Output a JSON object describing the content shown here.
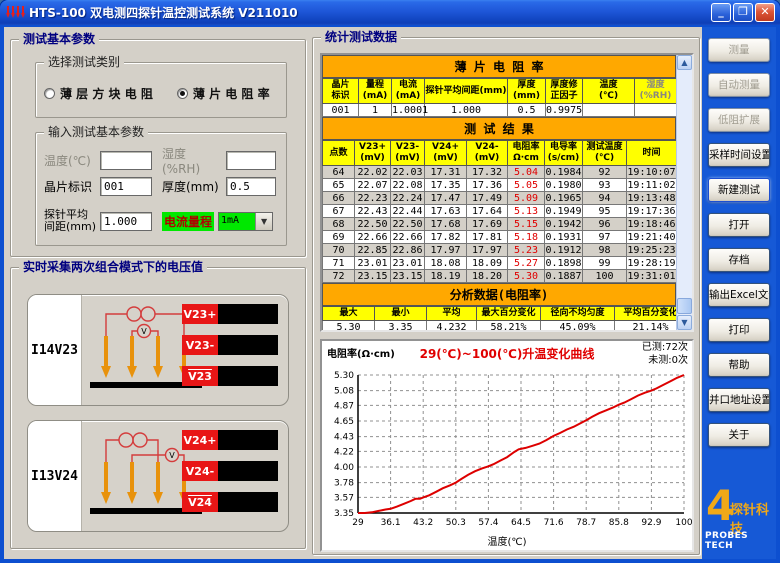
{
  "window": {
    "title": "HTS-100 双电测四探针温控测试系统  V211010"
  },
  "titlebar": {
    "minimize": "_",
    "restore": "❐",
    "close": "✕"
  },
  "left": {
    "params_group": {
      "title": "测试基本参数",
      "category_group": {
        "title": "选择测试类别",
        "radios": [
          {
            "label": "薄 层 方 块 电 阻",
            "selected": false
          },
          {
            "label": "薄 片 电 阻 率",
            "selected": true
          }
        ]
      },
      "input_group": {
        "title": "输入测试基本参数",
        "temp_label": "温度(℃)",
        "temp_value": "",
        "humidity_label": "湿度(%RH)",
        "humidity_value": "",
        "wafer_label": "晶片标识",
        "wafer_value": "001",
        "thickness_label": "厚度(mm)",
        "thickness_value": "0.5",
        "spacing_label_line1": "探针平均",
        "spacing_label_line2": "间距(mm)",
        "spacing_value": "1.000",
        "range_label": "电流量程",
        "range_value": "1mA"
      }
    },
    "voltage_group": {
      "title": "实时采集两次组合模式下的电压值",
      "panels": [
        {
          "mode": "I14V23",
          "labels": [
            "V23+",
            "V23-",
            "V23"
          ]
        },
        {
          "mode": "I13V24",
          "labels": [
            "V24+",
            "V24-",
            "V24"
          ]
        }
      ]
    }
  },
  "stats": {
    "title": "统计测试数据",
    "sheet_table": {
      "section": "薄 片 电 阻 率",
      "headers": [
        "晶片\n标识",
        "量程\n(mA)",
        "电流\n(mA)",
        "探针平均间距(mm)",
        "厚度\n(mm)",
        "厚度修\n正因子",
        "温度\n(℃)",
        "湿度\n(%RH)"
      ],
      "gray_headers": [
        7
      ],
      "widths": [
        36,
        33,
        33,
        83,
        38,
        37,
        52,
        42
      ],
      "rows": [
        [
          "001",
          "1",
          "1.0001",
          "1.000",
          "0.5",
          "0.9975",
          "",
          ""
        ]
      ]
    },
    "result_table": {
      "section": "测 试 结 果",
      "headers": [
        "点数",
        "V23+\n(mV)",
        "V23-\n(mV)",
        "V24+\n(mV)",
        "V24-\n(mV)",
        "电阻率\nΩ·cm",
        "电导率\n(s/cm)",
        "测试温度\n(℃)",
        "时间"
      ],
      "widths": [
        32,
        36,
        34,
        42,
        41,
        37,
        38,
        44,
        50
      ],
      "red_col": 5,
      "zebra": true,
      "rows": [
        [
          "64",
          "22.02",
          "22.03",
          "17.31",
          "17.32",
          "5.04",
          "0.1984",
          "92",
          "19:10:07"
        ],
        [
          "65",
          "22.07",
          "22.08",
          "17.35",
          "17.36",
          "5.05",
          "0.1980",
          "93",
          "19:11:02"
        ],
        [
          "66",
          "22.23",
          "22.24",
          "17.47",
          "17.49",
          "5.09",
          "0.1965",
          "94",
          "19:13:48"
        ],
        [
          "67",
          "22.43",
          "22.44",
          "17.63",
          "17.64",
          "5.13",
          "0.1949",
          "95",
          "19:17:36"
        ],
        [
          "68",
          "22.50",
          "22.50",
          "17.68",
          "17.69",
          "5.15",
          "0.1942",
          "96",
          "19:18:46"
        ],
        [
          "69",
          "22.66",
          "22.66",
          "17.82",
          "17.81",
          "5.18",
          "0.1931",
          "97",
          "19:21:40"
        ],
        [
          "70",
          "22.85",
          "22.86",
          "17.97",
          "17.97",
          "5.23",
          "0.1912",
          "98",
          "19:25:23"
        ],
        [
          "71",
          "23.01",
          "23.01",
          "18.08",
          "18.09",
          "5.27",
          "0.1898",
          "99",
          "19:28:19"
        ],
        [
          "72",
          "23.15",
          "23.15",
          "18.19",
          "18.20",
          "5.30",
          "0.1887",
          "100",
          "19:31:01"
        ]
      ]
    },
    "analysis_table": {
      "section": "分析数据(电阻率)",
      "headers": [
        "最大",
        "最小",
        "平均",
        "最大百分变化",
        "径向不均匀度",
        "平均百分变化"
      ],
      "widths": [
        52,
        52,
        50,
        64,
        74,
        72
      ],
      "rows": [
        [
          "5.30",
          "3.35",
          "4.232",
          "58.21%",
          "45.09%",
          "21.14%"
        ]
      ]
    },
    "counters": {
      "measured": "已测:72次",
      "remaining": "未测:0次"
    }
  },
  "chart_data": {
    "type": "line",
    "title": "29(℃)~100(℃)升温变化曲线",
    "xlabel": "温度(℃)",
    "ylabel": "电阻率(Ω·cm)",
    "xlim": [
      29,
      100
    ],
    "ylim": [
      3.35,
      5.3
    ],
    "xticks": [
      29,
      36.1,
      43.2,
      50.3,
      57.4,
      64.5,
      71.6,
      78.7,
      85.8,
      92.9,
      100
    ],
    "yticks": [
      5.3,
      5.08,
      4.87,
      4.65,
      4.43,
      4.22,
      4.0,
      3.78,
      3.57,
      3.35
    ],
    "grid": true,
    "line_color": "#dd0000",
    "series": [
      {
        "name": "电阻率",
        "points": [
          [
            29,
            3.35
          ],
          [
            30.5,
            3.35
          ],
          [
            32,
            3.36
          ],
          [
            33.5,
            3.38
          ],
          [
            35,
            3.4
          ],
          [
            36.1,
            3.41
          ],
          [
            37.5,
            3.44
          ],
          [
            39,
            3.48
          ],
          [
            40.5,
            3.52
          ],
          [
            41.5,
            3.55
          ],
          [
            42.5,
            3.55
          ],
          [
            43.2,
            3.57
          ],
          [
            44.5,
            3.6
          ],
          [
            46,
            3.65
          ],
          [
            47.5,
            3.7
          ],
          [
            49,
            3.74
          ],
          [
            50.3,
            3.78
          ],
          [
            51.5,
            3.83
          ],
          [
            53,
            3.89
          ],
          [
            54.5,
            3.94
          ],
          [
            56,
            3.98
          ],
          [
            57.4,
            4.01
          ],
          [
            58.5,
            4.04
          ],
          [
            60,
            4.09
          ],
          [
            61.5,
            4.14
          ],
          [
            63,
            4.21
          ],
          [
            64,
            4.25
          ],
          [
            65.5,
            4.27
          ],
          [
            67,
            4.3
          ],
          [
            68.5,
            4.33
          ],
          [
            70,
            4.38
          ],
          [
            71.6,
            4.44
          ],
          [
            73,
            4.48
          ],
          [
            74.5,
            4.53
          ],
          [
            76,
            4.57
          ],
          [
            77.5,
            4.62
          ],
          [
            78.7,
            4.66
          ],
          [
            80,
            4.71
          ],
          [
            81.5,
            4.76
          ],
          [
            83,
            4.8
          ],
          [
            84.5,
            4.84
          ],
          [
            85.8,
            4.88
          ],
          [
            87,
            4.91
          ],
          [
            88.5,
            4.96
          ],
          [
            90,
            5.01
          ],
          [
            91.5,
            5.05
          ],
          [
            92.9,
            5.08
          ],
          [
            94,
            5.11
          ],
          [
            95.5,
            5.16
          ],
          [
            97,
            5.21
          ],
          [
            98.5,
            5.26
          ],
          [
            100,
            5.3
          ]
        ]
      }
    ]
  },
  "sidebar": {
    "buttons": [
      {
        "name": "measure",
        "label": "测量",
        "enabled": false
      },
      {
        "name": "auto-measure",
        "label": "自动测量",
        "enabled": false
      },
      {
        "name": "low-resistance-extend",
        "label": "低阻扩展",
        "enabled": false
      },
      {
        "name": "sampling-time-settings",
        "label": "采样时间设置",
        "enabled": true
      },
      {
        "name": "new-test",
        "label": "新建测试",
        "enabled": true,
        "focused": true
      },
      {
        "name": "open",
        "label": "打开",
        "enabled": true
      },
      {
        "name": "archive",
        "label": "存档",
        "enabled": true
      },
      {
        "name": "export-excel",
        "label": "输出Excel文件",
        "enabled": true
      },
      {
        "name": "print",
        "label": "打印",
        "enabled": true
      },
      {
        "name": "help",
        "label": "帮助",
        "enabled": true
      },
      {
        "name": "lpt-address-settings",
        "label": "并口地址设置",
        "enabled": true
      },
      {
        "name": "about",
        "label": "关于",
        "enabled": true
      }
    ],
    "logo": {
      "big": "4",
      "cn": "探针科技",
      "en": "PROBES TECH"
    }
  }
}
